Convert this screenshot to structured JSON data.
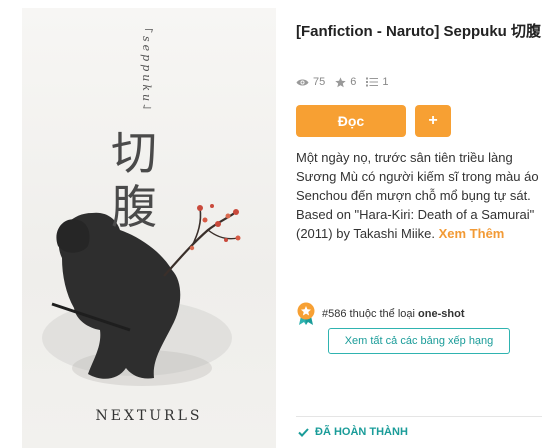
{
  "cover": {
    "roman_title": "「seppuku」",
    "kanji_title": "切腹",
    "publisher": "NEXTURLS"
  },
  "story": {
    "title": "[Fanfiction - Naruto] Seppuku 切腹",
    "stats": {
      "views": "75",
      "stars": "6",
      "parts": "1"
    },
    "read_label": "Đọc",
    "add_label": "+",
    "description": "Một ngày nọ, trước sân tiên triều làng Sương Mù có người kiếm sĩ trong màu áo Senchou đến mượn chỗ mổ bụng tự sát. Based on \"Hara-Kiri: Death of a Samurai\" (2011) by Takashi Miike.",
    "more_label": "Xem Thêm",
    "rank_number": "#586",
    "rank_mid": " thuộc thể loại ",
    "rank_tag": "one-shot",
    "rankings_button": "Xem tất cả các bảng xếp hạng",
    "status": "ĐÃ HOÀN THÀNH"
  },
  "colors": {
    "accent": "#f7a033",
    "teal": "#1a9c99",
    "text": "#333333"
  }
}
